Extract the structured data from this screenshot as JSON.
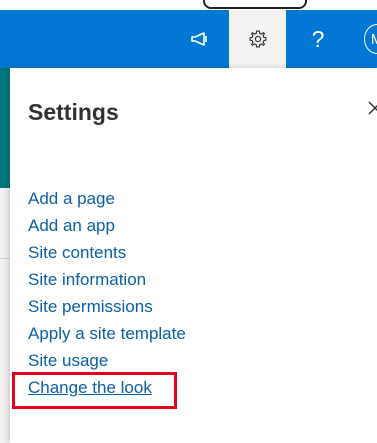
{
  "colors": {
    "suitebar": "#0078d4",
    "link": "#0b5fa5",
    "highlight": "#e3001b",
    "site_accent": "#03787c"
  },
  "suitebar": {
    "icons": [
      "megaphone-icon",
      "gear-icon",
      "help-icon",
      "avatar"
    ],
    "help_glyph": "?",
    "avatar_initial": "M"
  },
  "settings_panel": {
    "title": "Settings",
    "close_icon": "close-icon",
    "items": [
      {
        "label": "Add a page"
      },
      {
        "label": "Add an app"
      },
      {
        "label": "Site contents"
      },
      {
        "label": "Site information"
      },
      {
        "label": "Site permissions"
      },
      {
        "label": "Apply a site template"
      },
      {
        "label": "Site usage"
      },
      {
        "label": "Change the look",
        "highlighted": true
      }
    ]
  }
}
